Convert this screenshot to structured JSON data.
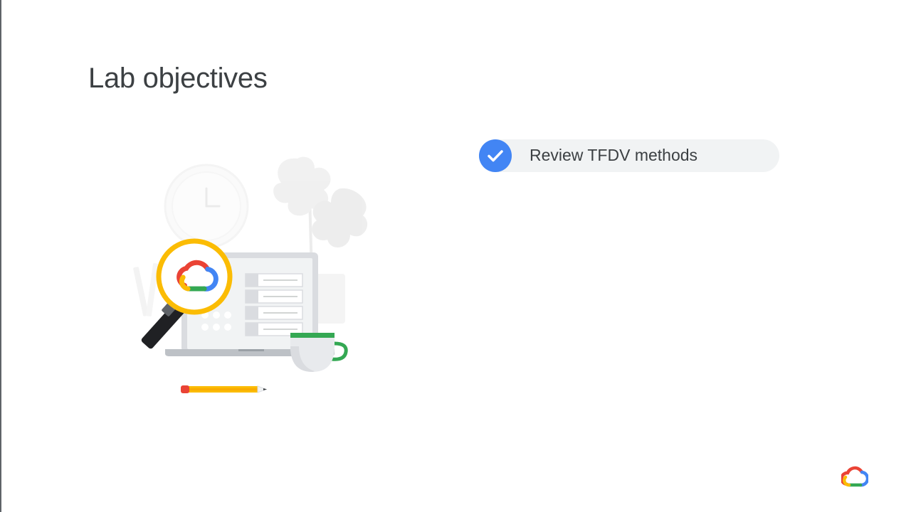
{
  "slide": {
    "title": "Lab objectives",
    "objectives": [
      {
        "label": "Review TFDV methods",
        "state": "checked"
      }
    ]
  },
  "icons": {
    "objective_marker": "check-icon",
    "brand": "google-cloud-logo-icon",
    "illustration": "magnifying-glass-laptop-illustration"
  },
  "colors": {
    "title_text": "#3c4043",
    "pill_background": "#f1f3f4",
    "check_blue": "#4285f4",
    "google_red": "#ea4335",
    "google_blue": "#4285f4",
    "google_yellow": "#fbbc04",
    "google_green": "#34a853"
  }
}
